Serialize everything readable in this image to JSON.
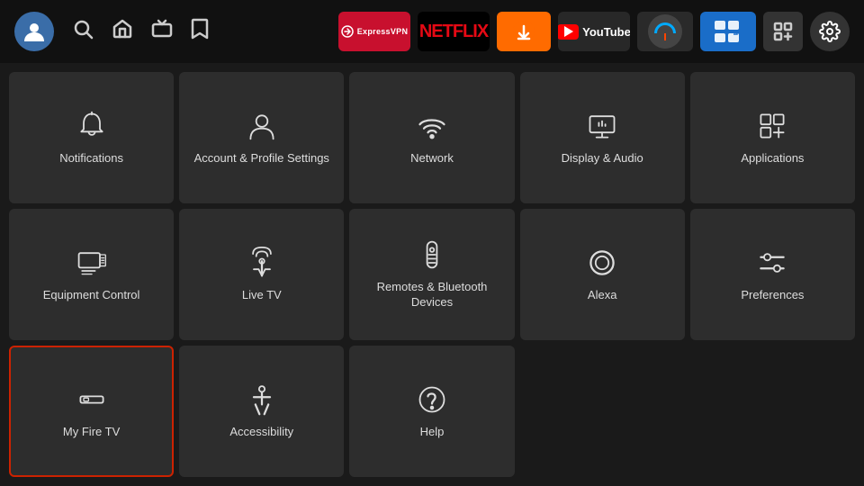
{
  "topbar": {
    "nav_icons": [
      "🔍",
      "🏠",
      "📺",
      "🔖"
    ],
    "apps": [
      {
        "id": "expressvpn",
        "label": "Express VPN",
        "type": "express"
      },
      {
        "id": "netflix",
        "label": "NETFLIX",
        "type": "netflix"
      },
      {
        "id": "downloader",
        "label": "Downloader",
        "type": "downloader"
      },
      {
        "id": "youtube",
        "label": "YouTube",
        "type": "youtube"
      },
      {
        "id": "speedtest",
        "label": "Internet Speed Test",
        "type": "speedtest"
      },
      {
        "id": "es",
        "label": "ES",
        "type": "es"
      },
      {
        "id": "add",
        "label": "+",
        "type": "add"
      }
    ],
    "settings_icon": "⚙"
  },
  "grid": {
    "tiles": [
      {
        "id": "notifications",
        "label": "Notifications",
        "icon": "bell"
      },
      {
        "id": "account",
        "label": "Account & Profile Settings",
        "icon": "person"
      },
      {
        "id": "network",
        "label": "Network",
        "icon": "wifi"
      },
      {
        "id": "display-audio",
        "label": "Display & Audio",
        "icon": "display"
      },
      {
        "id": "applications",
        "label": "Applications",
        "icon": "apps"
      },
      {
        "id": "equipment",
        "label": "Equipment Control",
        "icon": "monitor"
      },
      {
        "id": "livetv",
        "label": "Live TV",
        "icon": "antenna"
      },
      {
        "id": "remotes",
        "label": "Remotes & Bluetooth Devices",
        "icon": "remote"
      },
      {
        "id": "alexa",
        "label": "Alexa",
        "icon": "alexa"
      },
      {
        "id": "preferences",
        "label": "Preferences",
        "icon": "sliders"
      },
      {
        "id": "myfiretv",
        "label": "My Fire TV",
        "icon": "firetv",
        "selected": true
      },
      {
        "id": "accessibility",
        "label": "Accessibility",
        "icon": "accessibility"
      },
      {
        "id": "help",
        "label": "Help",
        "icon": "help"
      }
    ]
  }
}
